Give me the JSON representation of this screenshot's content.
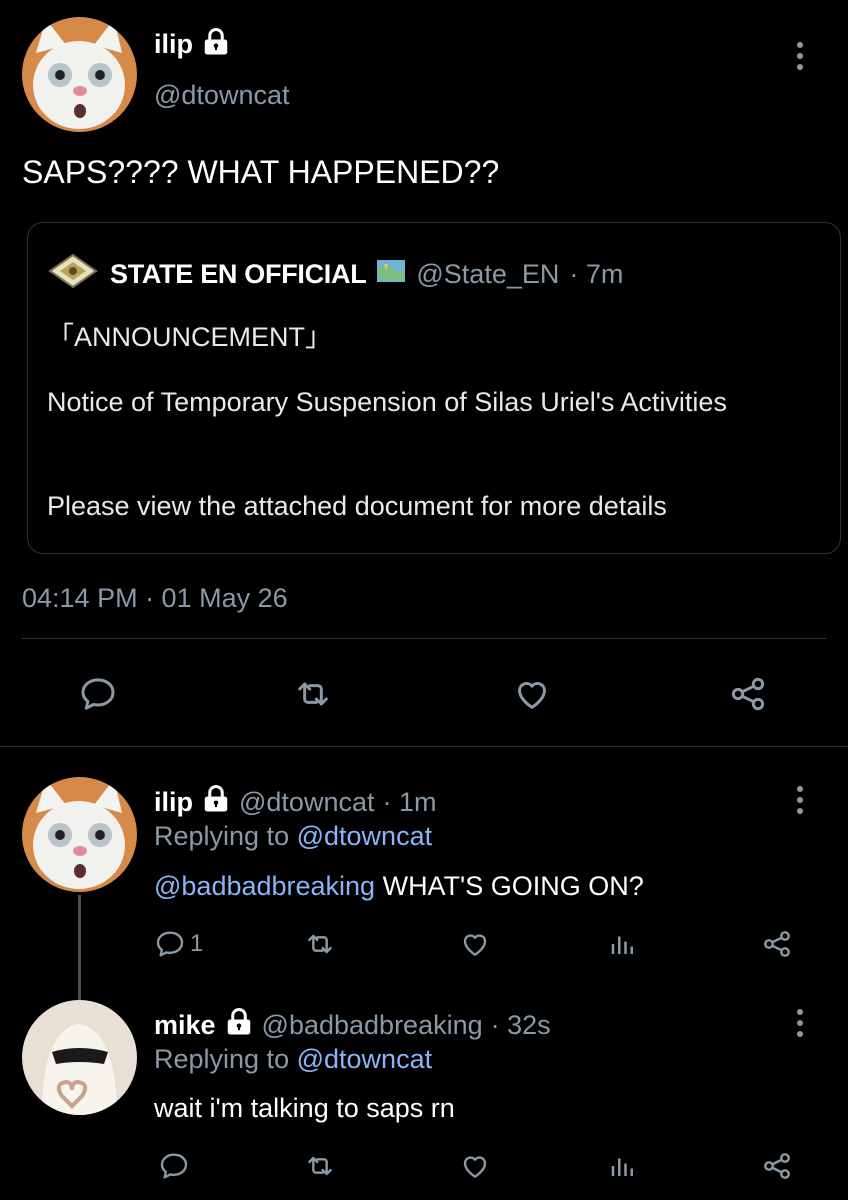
{
  "main_tweet": {
    "display_name": "ilip",
    "handle": "@dtowncat",
    "text": "SAPS???? WHAT HAPPENED??",
    "timestamp": "04:14 PM · 01 May 26",
    "quoted": {
      "display_name": "STATE EN OFFICIAL",
      "handle": "@State_EN",
      "age": "· 7m",
      "line1": "「ANNOUNCEMENT」",
      "line2": "Notice of Temporary Suspension of Silas Uriel's Activities",
      "line3": "Please view the attached document for more details"
    },
    "actions": [
      "reply-icon",
      "retweet-icon",
      "like-icon",
      "share-icon"
    ]
  },
  "replies": [
    {
      "display_name": "ilip",
      "handle": "@dtowncat",
      "age": "· 1m",
      "replying_prefix": "Replying to",
      "replying_to": "@dtowncat",
      "mention": "@badbadbreaking",
      "text": " WHAT'S GOING ON?",
      "reply_count": "1"
    },
    {
      "display_name": "mike",
      "handle": "@badbadbreaking",
      "age": "· 32s",
      "replying_prefix": "Replying to",
      "replying_to": "@dtowncat",
      "text": "wait i'm talking to saps rn"
    }
  ],
  "colors": {
    "background": "#000000",
    "text": "#e7e9ea",
    "muted": "#8b98a5",
    "link": "#8ab4f8",
    "border": "#2f3336"
  }
}
